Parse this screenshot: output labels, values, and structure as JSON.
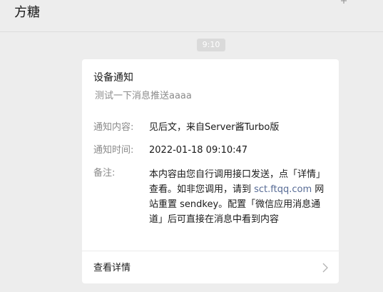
{
  "header": {
    "title": "方糖",
    "pin_icon": "pin-icon"
  },
  "message": {
    "time": "9:10",
    "card": {
      "title": "设备通知",
      "subtitle": "测试一下消息推送aaaa",
      "fields": [
        {
          "label": "通知内容:",
          "value": "见后文，来自Server酱Turbo版"
        },
        {
          "label": "通知时间:",
          "value": "2022-01-18 09:10:47"
        }
      ],
      "note": {
        "label": "备注:",
        "text_part1": "本内容由您自行调用接口发送，点「详情」查看。如非您调用，请到 ",
        "link": "sct.ftqq.com",
        "text_part2": " 网站重置 sendkey。配置「微信应用消息通道」后可直接在消息中看到内容"
      },
      "details_label": "查看详情",
      "details_icon": "chevron-right-icon"
    }
  },
  "colors": {
    "background": "#ededed",
    "card": "#ffffff",
    "link": "#576b95",
    "muted_text": "#8a8a8a"
  }
}
